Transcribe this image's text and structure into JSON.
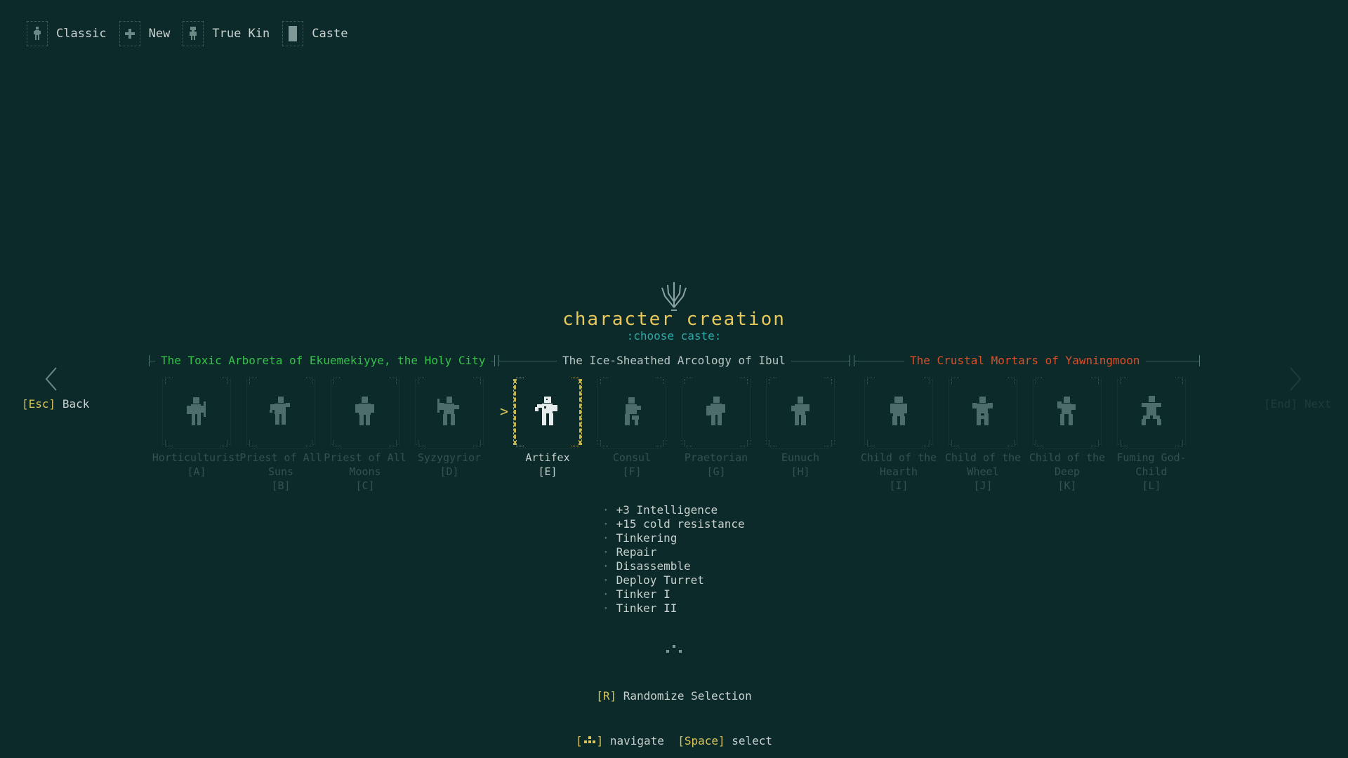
{
  "breadcrumb": [
    {
      "label": "Classic",
      "icon": "figure-icon"
    },
    {
      "label": "New",
      "icon": "plus-icon"
    },
    {
      "label": "True Kin",
      "icon": "person-icon"
    },
    {
      "label": "Caste",
      "icon": "block-icon"
    }
  ],
  "header": {
    "title": "character creation",
    "subtitle": ":choose caste:"
  },
  "regions": [
    {
      "label": "The Toxic Arboreta of Ekuemekiyye, the Holy City",
      "color": "#35c24a"
    },
    {
      "label": "The Ice-Sheathed Arcology of Ibul",
      "color": "#b9c7c5"
    },
    {
      "label": "The Crustal Mortars of Yawningmoon",
      "color": "#d9502a"
    }
  ],
  "castes": [
    {
      "name": "Horticulturist",
      "key": "[A]"
    },
    {
      "name": "Priest of All Suns",
      "key": "[B]"
    },
    {
      "name": "Priest of All Moons",
      "key": "[C]"
    },
    {
      "name": "Syzygyrior",
      "key": "[D]"
    },
    {
      "name": "Artifex",
      "key": "[E]"
    },
    {
      "name": "Consul",
      "key": "[F]"
    },
    {
      "name": "Praetorian",
      "key": "[G]"
    },
    {
      "name": "Eunuch",
      "key": "[H]"
    },
    {
      "name": "Child of the Hearth",
      "key": "[I]"
    },
    {
      "name": "Child of the Wheel",
      "key": "[J]"
    },
    {
      "name": "Child of the Deep",
      "key": "[K]"
    },
    {
      "name": "Fuming God-Child",
      "key": "[L]"
    }
  ],
  "selected_caste": "Artifex",
  "selector_glyph": ">",
  "nav": {
    "back_key": "[Esc]",
    "back_label": "Back",
    "next_key": "[End]",
    "next_label": "Next"
  },
  "abilities": [
    "+3 Intelligence",
    "+15 cold resistance",
    "Tinkering",
    "Repair",
    "Disassemble",
    "Deploy Turret",
    "Tinker I",
    "Tinker II"
  ],
  "randomize": {
    "key": "[R]",
    "label": "Randomize Selection"
  },
  "footer": {
    "navigate_label": "navigate",
    "select_key": "[Space]",
    "select_label": "select"
  },
  "colors": {
    "background": "#0c2a29",
    "accent_yellow": "#d8c45a",
    "subtitle_cyan": "#2fa8a8",
    "figure_dim": "#4d6d6b",
    "figure_selected": "#e6eceb"
  }
}
